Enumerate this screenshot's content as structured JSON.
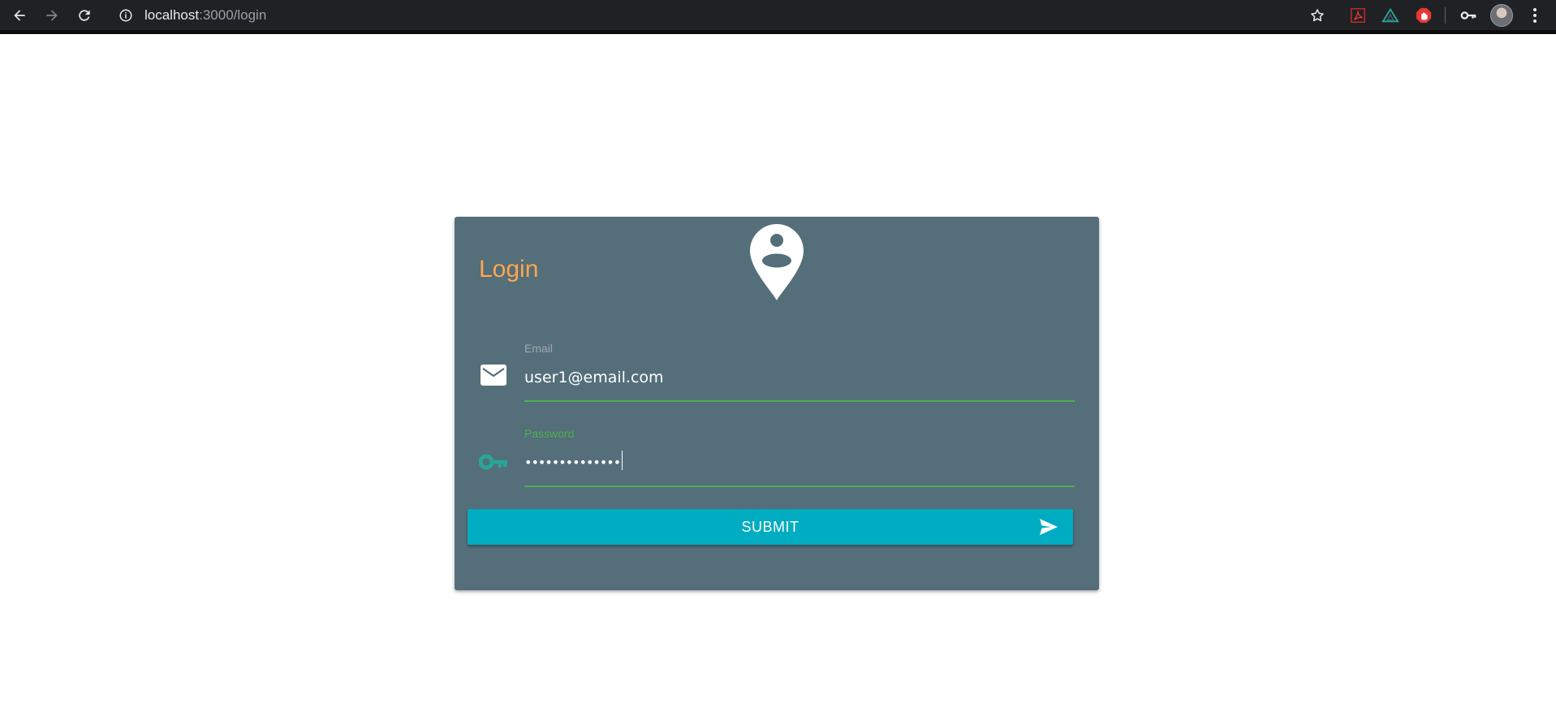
{
  "browser": {
    "url_host": "localhost",
    "url_rest": ":3000/login",
    "back_icon": "arrow-left-icon",
    "forward_icon": "arrow-right-icon",
    "reload_icon": "reload-icon",
    "info_icon": "info-icon",
    "star_icon": "star-icon",
    "extensions": [
      "pdf-extension-icon",
      "vue-devtools-icon",
      "adblock-icon",
      "key-manager-icon"
    ],
    "menu_icon": "kebab-menu-icon"
  },
  "login": {
    "title": "Login",
    "logo_icon": "user-location-pin-icon",
    "email": {
      "label": "Email",
      "value": "user1@email.com",
      "icon": "mail-icon"
    },
    "password": {
      "label": "Password",
      "value": "••••••••••••••",
      "icon": "key-icon"
    },
    "submit": {
      "label": "SUBMIT",
      "icon": "send-icon"
    }
  },
  "colors": {
    "card": "#546e7a",
    "title": "#ffa64d",
    "focus_green": "#4caf50",
    "button": "#00acc1",
    "muted_label": "#9eaab0",
    "key_icon": "#26a69a"
  }
}
